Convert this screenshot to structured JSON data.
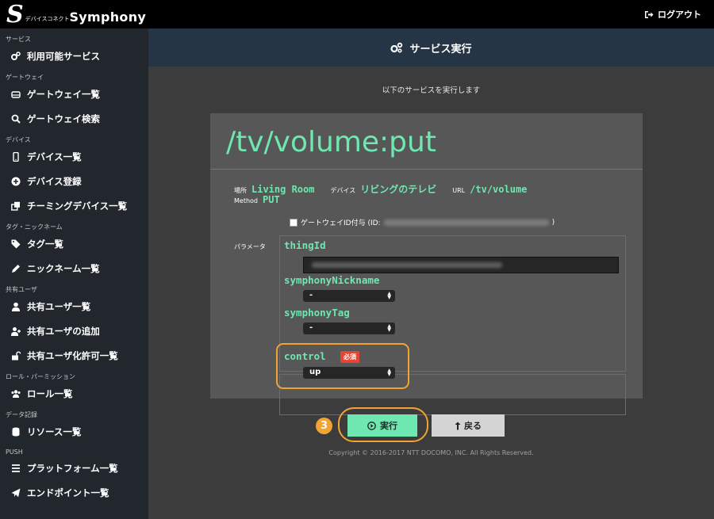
{
  "app": {
    "brand_small": "デバイスコネクト",
    "brand_big": "Symphony",
    "logout_label": "ログアウト"
  },
  "sidebar": {
    "sections": [
      {
        "label": "サービス",
        "items": [
          {
            "label": "利用可能サービス",
            "icon": "gears-icon"
          }
        ]
      },
      {
        "label": "ゲートウェイ",
        "items": [
          {
            "label": "ゲートウェイ一覧",
            "icon": "hdd-icon"
          },
          {
            "label": "ゲートウェイ検索",
            "icon": "search-icon"
          }
        ]
      },
      {
        "label": "デバイス",
        "items": [
          {
            "label": "デバイス一覧",
            "icon": "mobile-icon"
          },
          {
            "label": "デバイス登録",
            "icon": "plus-circle-icon"
          },
          {
            "label": "チーミングデバイス一覧",
            "icon": "clone-icon"
          }
        ]
      },
      {
        "label": "タグ・ニックネーム",
        "items": [
          {
            "label": "タグ一覧",
            "icon": "tags-icon"
          },
          {
            "label": "ニックネーム一覧",
            "icon": "pencil-icon"
          }
        ]
      },
      {
        "label": "共有ユーザ",
        "items": [
          {
            "label": "共有ユーザ一覧",
            "icon": "user-icon"
          },
          {
            "label": "共有ユーザの追加",
            "icon": "user-plus-icon"
          },
          {
            "label": "共有ユーザ化許可一覧",
            "icon": "unlock-icon"
          }
        ]
      },
      {
        "label": "ロール・パーミッション",
        "items": [
          {
            "label": "ロール一覧",
            "icon": "users-icon"
          }
        ]
      },
      {
        "label": "データ記録",
        "items": [
          {
            "label": "リソース一覧",
            "icon": "database-icon"
          }
        ]
      },
      {
        "label": "PUSH",
        "items": [
          {
            "label": "プラットフォーム一覧",
            "icon": "list-icon"
          },
          {
            "label": "エンドポイント一覧",
            "icon": "send-icon"
          }
        ]
      }
    ]
  },
  "main": {
    "header_title": "サービス実行",
    "subtitle": "以下のサービスを実行します",
    "service_path": "/tv/volume:put",
    "meta": {
      "place_label": "場所",
      "place_value": "Living Room",
      "device_label": "デバイス",
      "device_value": "リビングのテレビ",
      "url_label": "URL",
      "url_value": "/tv/volume",
      "method_label": "Method",
      "method_value": "PUT"
    },
    "checkbox_label_prefix": "ゲートウェイID付与 (ID:",
    "checkbox_label_suffix": ")",
    "params_label": "パラメータ",
    "params": {
      "thingId": "thingId",
      "nickname": "symphonyNickname",
      "nickname_value": "-",
      "tag": "symphonyTag",
      "tag_value": "-",
      "control": "control",
      "control_value": "up",
      "required_badge": "必須"
    },
    "run_label": "実行",
    "back_label": "戻る",
    "step_number": "3",
    "copyright": "Copyright © 2016-2017 NTT DOCOMO, INC. All Rights Reserved."
  },
  "colors": {
    "accent": "#6fe7b0",
    "highlight": "#f3a234",
    "header": "#253545",
    "required": "#e8442f"
  }
}
